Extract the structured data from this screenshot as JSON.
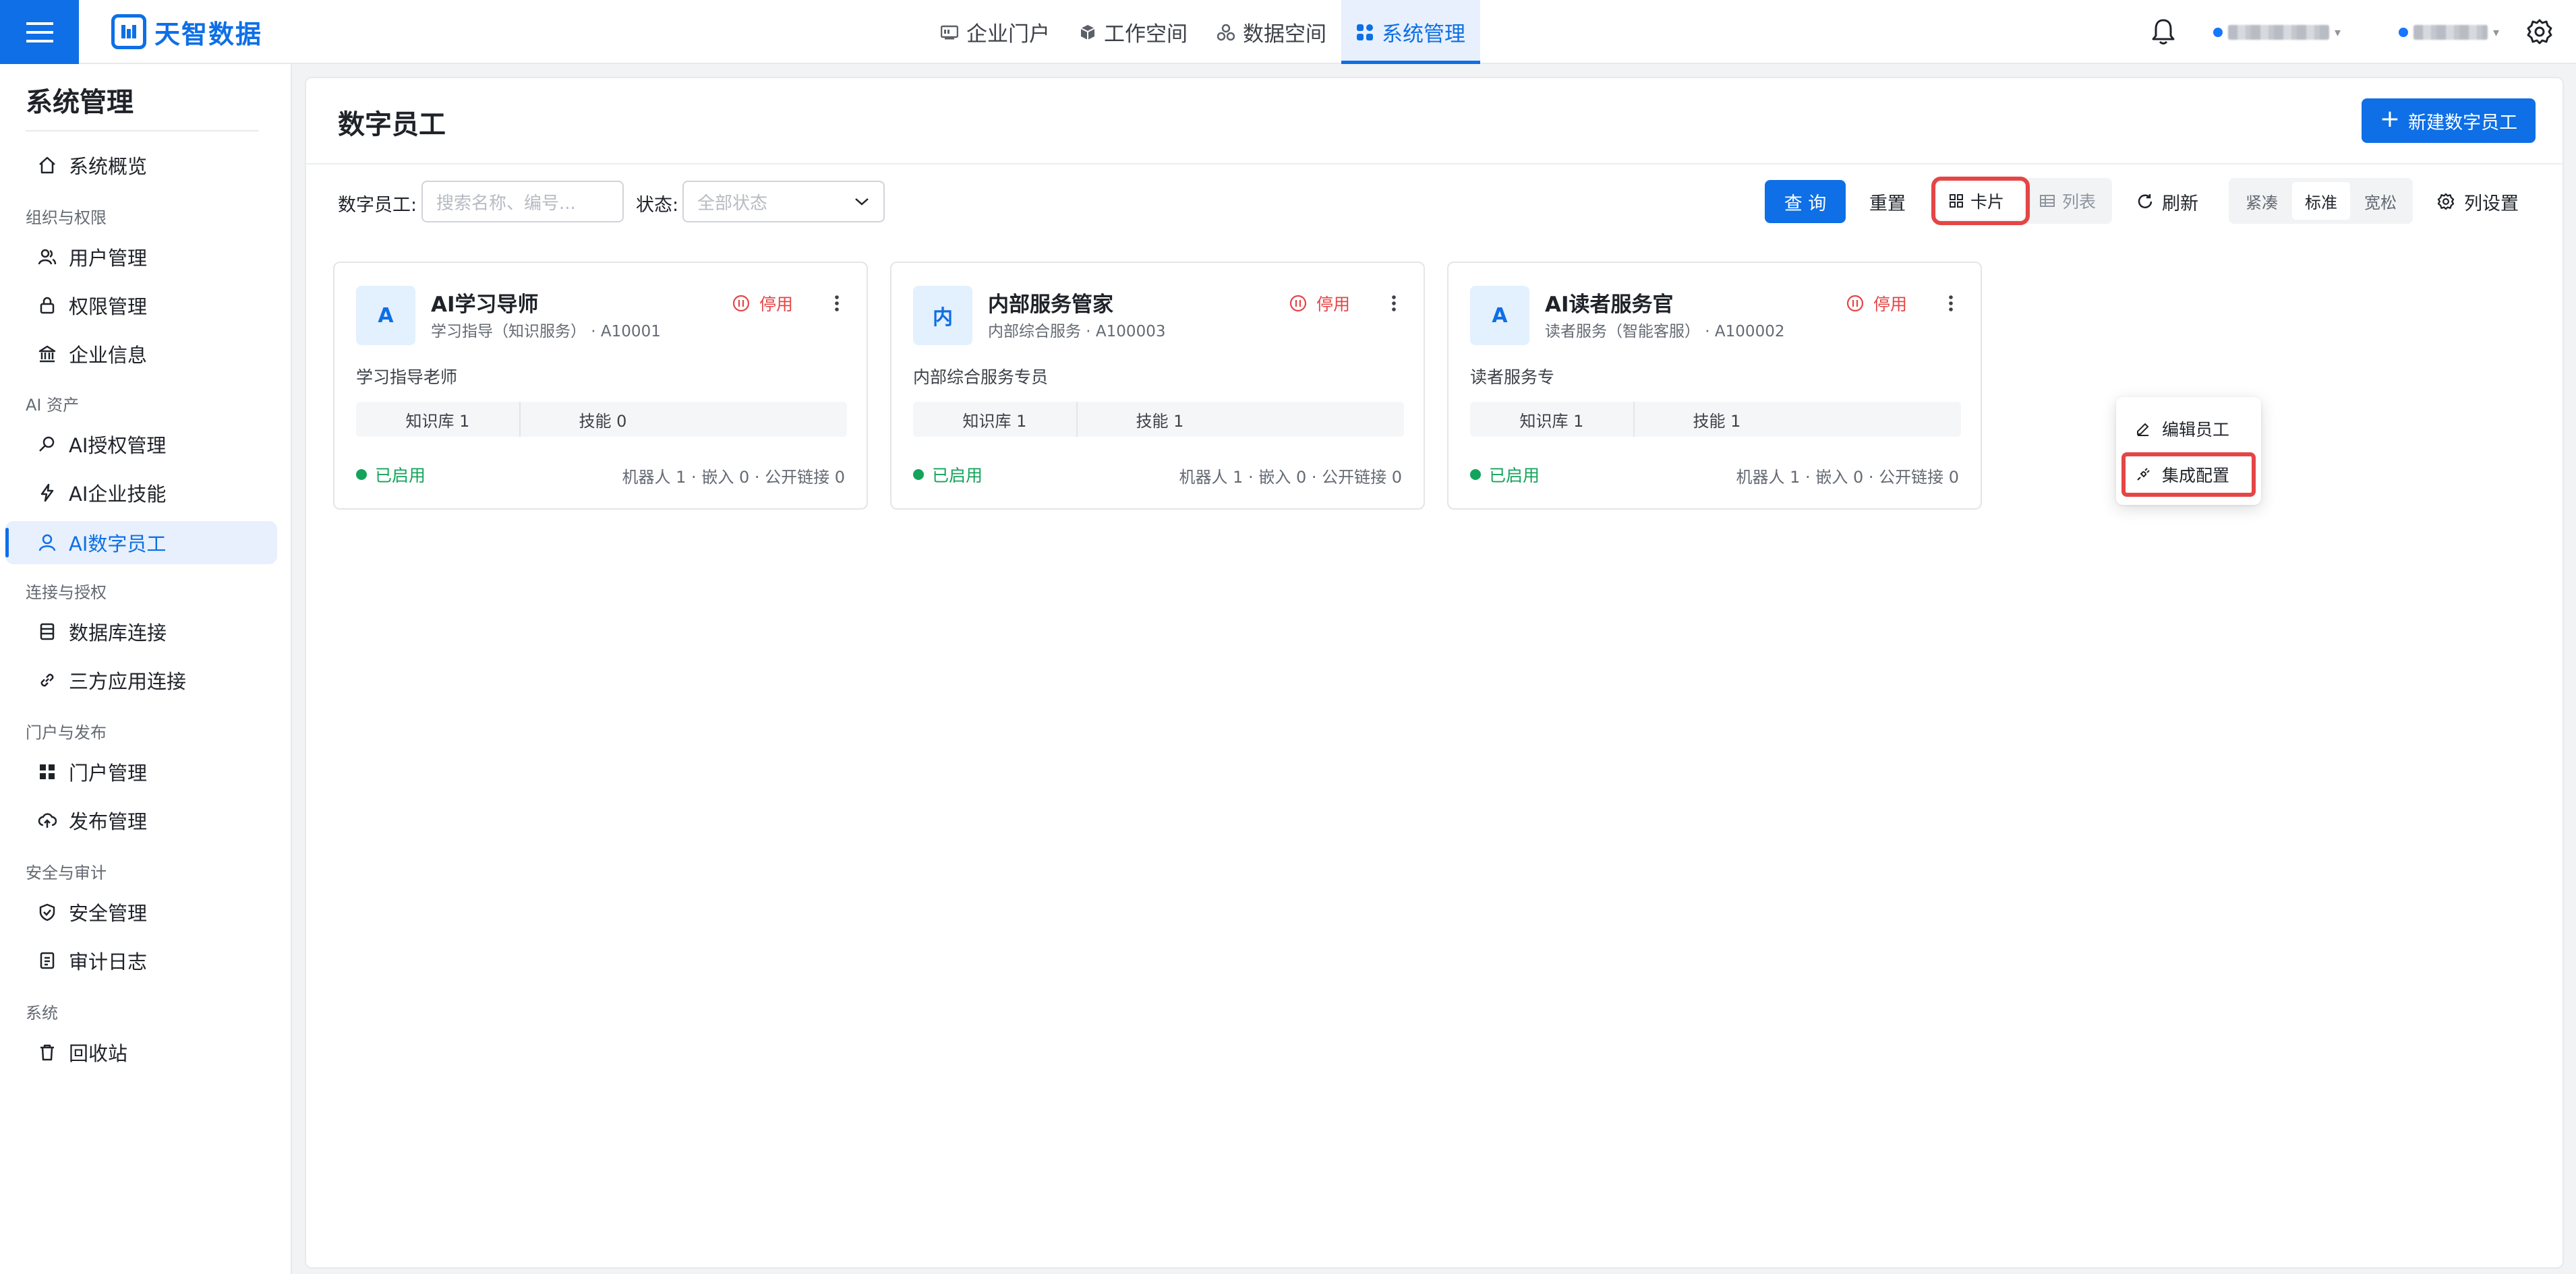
{
  "topbar": {
    "brand_name": "天智数据",
    "nav": [
      {
        "label": "企业门户",
        "icon": "portal-icon"
      },
      {
        "label": "工作空间",
        "icon": "cube-icon"
      },
      {
        "label": "数据空间",
        "icon": "data-icon"
      },
      {
        "label": "系统管理",
        "icon": "grid-icon",
        "active": true
      }
    ],
    "accent_color": "#0e6fe6"
  },
  "sidebar": {
    "title": "系统管理",
    "top_items": [
      {
        "label": "系统概览",
        "icon": "home-icon"
      }
    ],
    "groups": [
      {
        "label": "组织与权限",
        "items": [
          {
            "label": "用户管理",
            "icon": "users-icon"
          },
          {
            "label": "权限管理",
            "icon": "lock-icon"
          },
          {
            "label": "企业信息",
            "icon": "bank-icon"
          }
        ]
      },
      {
        "label": "AI 资产",
        "items": [
          {
            "label": "AI授权管理",
            "icon": "key-icon"
          },
          {
            "label": "AI企业技能",
            "icon": "bolt-icon"
          },
          {
            "label": "AI数字员工",
            "icon": "user-icon",
            "active": true
          }
        ]
      },
      {
        "label": "连接与授权",
        "items": [
          {
            "label": "数据库连接",
            "icon": "database-icon"
          },
          {
            "label": "三方应用连接",
            "icon": "link-icon"
          }
        ]
      },
      {
        "label": "门户与发布",
        "items": [
          {
            "label": "门户管理",
            "icon": "apps-icon"
          },
          {
            "label": "发布管理",
            "icon": "cloud-upload-icon"
          }
        ]
      },
      {
        "label": "安全与审计",
        "items": [
          {
            "label": "安全管理",
            "icon": "shield-icon"
          },
          {
            "label": "审计日志",
            "icon": "log-icon"
          }
        ]
      },
      {
        "label": "系统",
        "items": [
          {
            "label": "回收站",
            "icon": "trash-icon"
          }
        ]
      }
    ]
  },
  "page": {
    "title": "数字员工",
    "new_button": "新建数字员工",
    "filters": {
      "name_label": "数字员工:",
      "name_placeholder": "搜索名称、编号...",
      "status_label": "状态:",
      "status_placeholder": "全部状态"
    },
    "actions": {
      "query": "查 询",
      "reset": "重置",
      "view_card": "卡片",
      "view_list": "列表",
      "refresh": "刷新",
      "density": [
        "紧凑",
        "标准",
        "宽松"
      ],
      "density_selected": "标准",
      "columns": "列设置"
    }
  },
  "cards": [
    {
      "avatar": "A",
      "name": "AI学习导师",
      "sub": "学习指导（知识服务） · A10001",
      "status_action": "停用",
      "desc": "学习指导老师",
      "kb": "知识库 1",
      "skills": "技能 0",
      "enabled": "已启用",
      "stats": "机器人 1 · 嵌入 0 · 公开链接 0"
    },
    {
      "avatar": "内",
      "name": "内部服务管家",
      "sub": "内部综合服务 · A100003",
      "status_action": "停用",
      "desc": "内部综合服务专员",
      "kb": "知识库 1",
      "skills": "技能 1",
      "enabled": "已启用",
      "stats": "机器人 1 · 嵌入 0 · 公开链接 0"
    },
    {
      "avatar": "A",
      "name": "AI读者服务官",
      "sub": "读者服务（智能客服） · A100002",
      "status_action": "停用",
      "desc": "读者服务专",
      "kb": "知识库 1",
      "skills": "技能 1",
      "enabled": "已启用",
      "stats": "机器人 1 · 嵌入 0 · 公开链接 0"
    }
  ],
  "card_menu": {
    "items": [
      "编辑员工",
      "集成配置"
    ],
    "highlighted": "集成配置"
  }
}
